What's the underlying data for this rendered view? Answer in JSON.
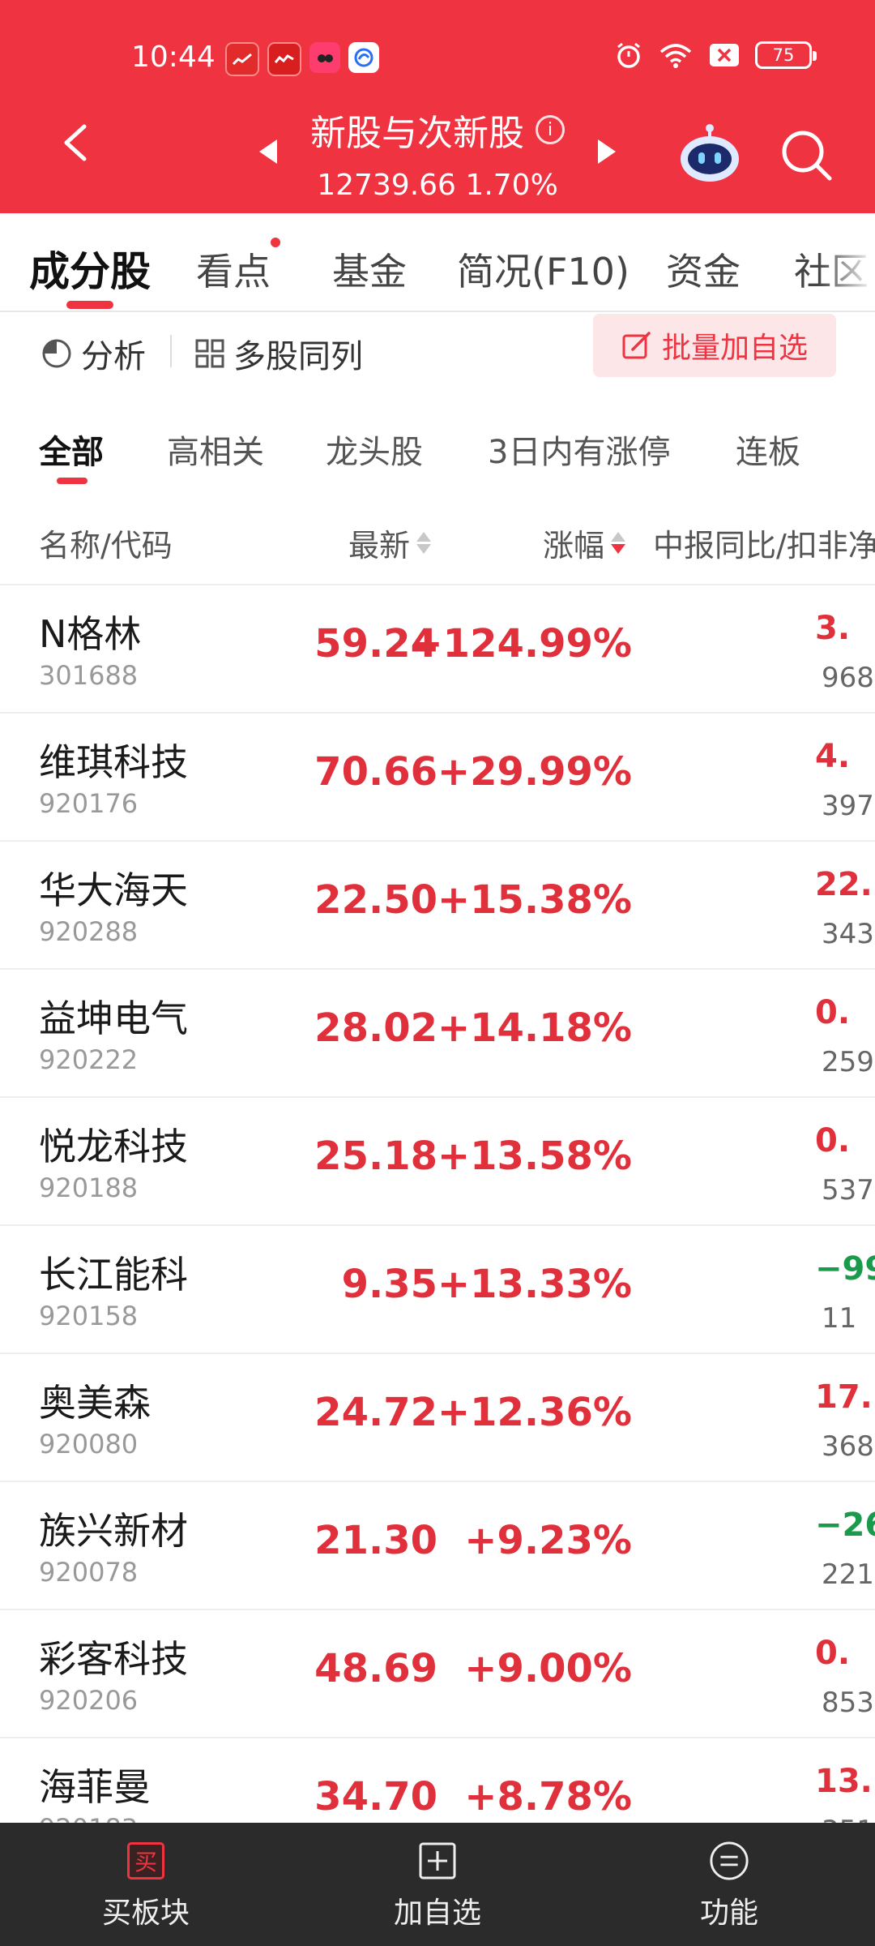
{
  "status": {
    "time": "10:44",
    "battery": "75"
  },
  "header": {
    "title": "新股与次新股",
    "info_glyph": "i",
    "index_value": "12739.66",
    "index_change": "1.70%"
  },
  "tabs": [
    {
      "label": "成分股",
      "active": true
    },
    {
      "label": "看点",
      "badge": true
    },
    {
      "label": "基金"
    },
    {
      "label": "简况(F10)"
    },
    {
      "label": "资金"
    },
    {
      "label": "社区"
    }
  ],
  "tools": {
    "analysis": "分析",
    "multi": "多股同列",
    "batch_add": "批量加自选"
  },
  "filters": [
    {
      "label": "全部",
      "active": true
    },
    {
      "label": "高相关"
    },
    {
      "label": "龙头股"
    },
    {
      "label": "3日内有涨停"
    },
    {
      "label": "连板"
    }
  ],
  "columns": {
    "name": "名称/代码",
    "latest": "最新",
    "change": "涨幅",
    "extra": "中报同比/扣非净"
  },
  "rows": [
    {
      "name": "N格林",
      "code": "301688",
      "price": "59.24",
      "change": "+124.99%",
      "extra1": "3.",
      "extra2": "968"
    },
    {
      "name": "维琪科技",
      "code": "920176",
      "price": "70.66",
      "change": "+29.99%",
      "extra1": "4.",
      "extra2": "397"
    },
    {
      "name": "华大海天",
      "code": "920288",
      "price": "22.50",
      "change": "+15.38%",
      "extra1": "22.",
      "extra2": "343"
    },
    {
      "name": "益坤电气",
      "code": "920222",
      "price": "28.02",
      "change": "+14.18%",
      "extra1": "0.",
      "extra2": "259"
    },
    {
      "name": "悦龙科技",
      "code": "920188",
      "price": "25.18",
      "change": "+13.58%",
      "extra1": "0.",
      "extra2": "537"
    },
    {
      "name": "长江能科",
      "code": "920158",
      "price": "9.35",
      "change": "+13.33%",
      "extra1": "−99.",
      "extra2": "11",
      "negative": true
    },
    {
      "name": "奥美森",
      "code": "920080",
      "price": "24.72",
      "change": "+12.36%",
      "extra1": "17.",
      "extra2": "368"
    },
    {
      "name": "族兴新材",
      "code": "920078",
      "price": "21.30",
      "change": "+9.23%",
      "extra1": "−26.",
      "extra2": "221",
      "negative": true
    },
    {
      "name": "彩客科技",
      "code": "920206",
      "price": "48.69",
      "change": "+9.00%",
      "extra1": "0.",
      "extra2": "853"
    },
    {
      "name": "海菲曼",
      "code": "920183",
      "price": "34.70",
      "change": "+8.78%",
      "extra1": "13.",
      "extra2": "351"
    }
  ],
  "bottom": {
    "buy_icon": "买",
    "buy": "买板块",
    "add": "加自选",
    "func": "功能"
  },
  "colors": {
    "brand_red": "#f03340",
    "up_red": "#e0303c",
    "down_green": "#1a9a4b",
    "bottom_bar": "#2b2b2b"
  }
}
